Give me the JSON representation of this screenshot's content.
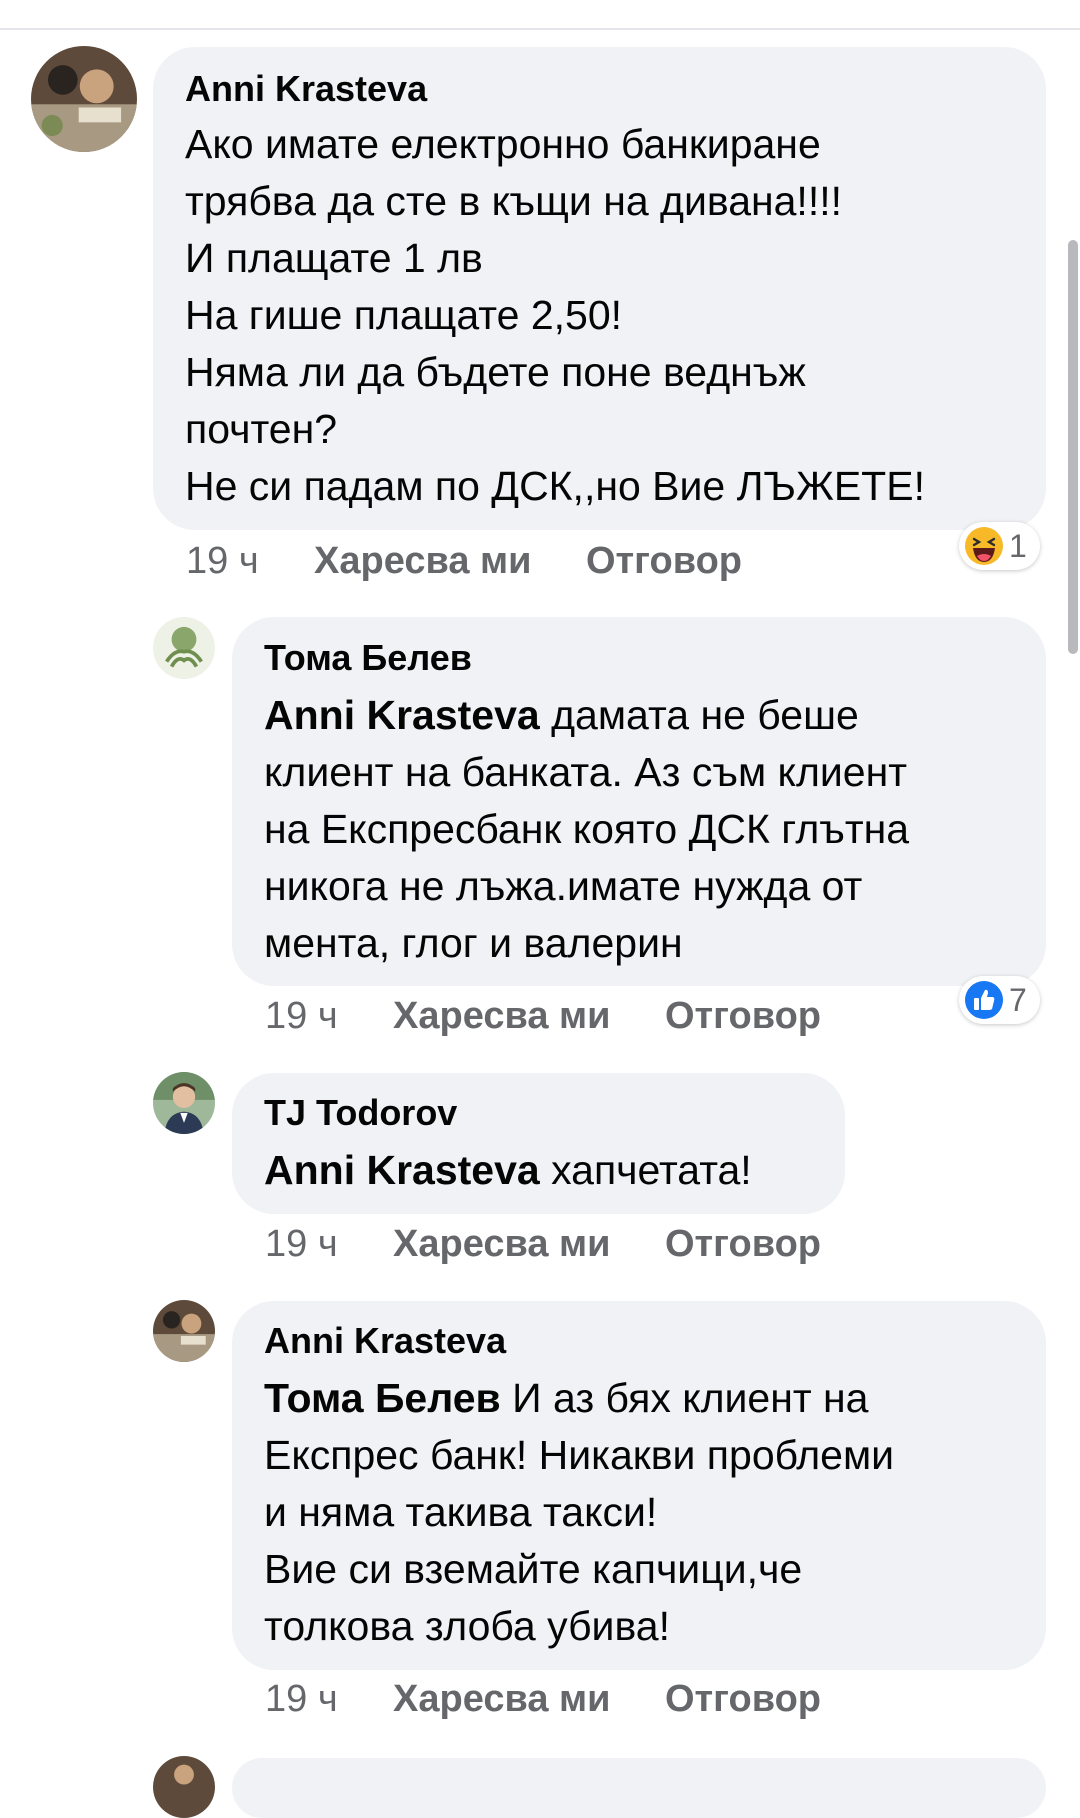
{
  "comments": [
    {
      "author": "Anni Krasteva",
      "lines": [
        "Ако имате електронно банкиране",
        "трябва да сте в къщи на дивана!!!!",
        "И плащате 1 лв",
        "На гише плащате 2,50!",
        "Няма ли да бъдете поне веднъж",
        "почтен?",
        "Не си падам по ДСК,,но Вие ЛЪЖЕТЕ!"
      ],
      "time": "19 ч",
      "like_label": "Харесва ми",
      "reply_label": "Отговор",
      "reaction": {
        "icon": "haha-emoji-icon",
        "count": "1"
      }
    },
    {
      "author": "Тома Белев",
      "mention": "Anni Krasteva",
      "first_line_rest": "дамата не беше",
      "lines": [
        "клиент на банката. Аз съм клиент",
        "на Експресбанк която ДСК глътна",
        "никога не лъжа.имате нужда от",
        "мента, глог и валерин"
      ],
      "time": "19 ч",
      "like_label": "Харесва ми",
      "reply_label": "Отговор",
      "reaction": {
        "icon": "like-thumb-icon",
        "count": "7"
      }
    },
    {
      "author": "TJ Todorov",
      "mention": "Anni Krasteva",
      "first_line_rest": "хапчетата!",
      "lines": [],
      "time": "19 ч",
      "like_label": "Харесва ми",
      "reply_label": "Отговор"
    },
    {
      "author": "Anni Krasteva",
      "mention": "Тома Белев",
      "first_line_rest": "И аз бях клиент на",
      "lines": [
        "Експрес банк! Никакви проблеми",
        "и няма такива такси!",
        "Вие си вземайте капчици,че",
        "толкова злоба убива!"
      ],
      "time": "19 ч",
      "like_label": "Харесва ми",
      "reply_label": "Отговор"
    }
  ],
  "colors": {
    "bubble": "#f0f2f5",
    "meta_text": "#65676b",
    "like_blue": "#1877f2",
    "haha_yellow": "#f7b928"
  }
}
